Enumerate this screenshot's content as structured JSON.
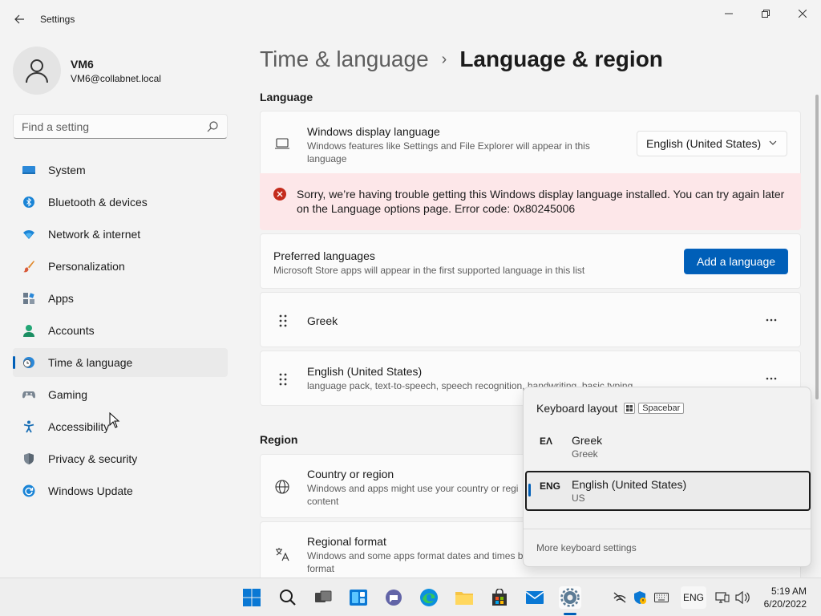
{
  "window": {
    "title": "Settings"
  },
  "profile": {
    "name": "VM6",
    "email": "VM6@collabnet.local"
  },
  "search": {
    "placeholder": "Find a setting"
  },
  "sidebar": {
    "items": [
      {
        "label": "System",
        "icon": "system-icon"
      },
      {
        "label": "Bluetooth & devices",
        "icon": "bluetooth-icon"
      },
      {
        "label": "Network & internet",
        "icon": "network-icon"
      },
      {
        "label": "Personalization",
        "icon": "brush-icon"
      },
      {
        "label": "Apps",
        "icon": "apps-icon"
      },
      {
        "label": "Accounts",
        "icon": "accounts-icon"
      },
      {
        "label": "Time & language",
        "icon": "time-language-icon",
        "active": true
      },
      {
        "label": "Gaming",
        "icon": "gaming-icon"
      },
      {
        "label": "Accessibility",
        "icon": "accessibility-icon"
      },
      {
        "label": "Privacy & security",
        "icon": "shield-icon"
      },
      {
        "label": "Windows Update",
        "icon": "update-icon"
      }
    ]
  },
  "breadcrumb": {
    "parent": "Time & language",
    "separator": "›",
    "current": "Language & region"
  },
  "language_section": {
    "title": "Language",
    "display_language": {
      "title": "Windows display language",
      "description": "Windows features like Settings and File Explorer will appear in this language",
      "value": "English (United States)"
    },
    "error": {
      "message": "Sorry, we’re having trouble getting this Windows display language installed. You can try again later on the Language options page. Error code: 0x80245006"
    },
    "preferred": {
      "title": "Preferred languages",
      "description": "Microsoft Store apps will appear in the first supported language in this list",
      "button": "Add a language"
    },
    "languages": [
      {
        "name": "Greek",
        "detail": ""
      },
      {
        "name": "English (United States)",
        "detail": "language pack, text-to-speech, speech recognition, handwriting, basic typing"
      }
    ]
  },
  "region_section": {
    "title": "Region",
    "country": {
      "title": "Country or region",
      "description": "Windows and apps might use your country or regi content"
    },
    "format": {
      "title": "Regional format",
      "description": "Windows and some apps format dates and times b format"
    }
  },
  "keyboard_flyout": {
    "title": "Keyboard layout",
    "shortcut_key": "Spacebar",
    "layouts": [
      {
        "code": "ΕΛ",
        "name": "Greek",
        "sub": "Greek",
        "selected": false
      },
      {
        "code": "ENG",
        "name": "English (United States)",
        "sub": "US",
        "selected": true
      }
    ],
    "more_link": "More keyboard settings"
  },
  "taskbar": {
    "lang": "ENG",
    "time": "5:19 AM",
    "date": "6/20/2022"
  },
  "colors": {
    "accent": "#005fb8",
    "error_bg": "#fde7e9",
    "error_icon": "#c42b1c"
  }
}
